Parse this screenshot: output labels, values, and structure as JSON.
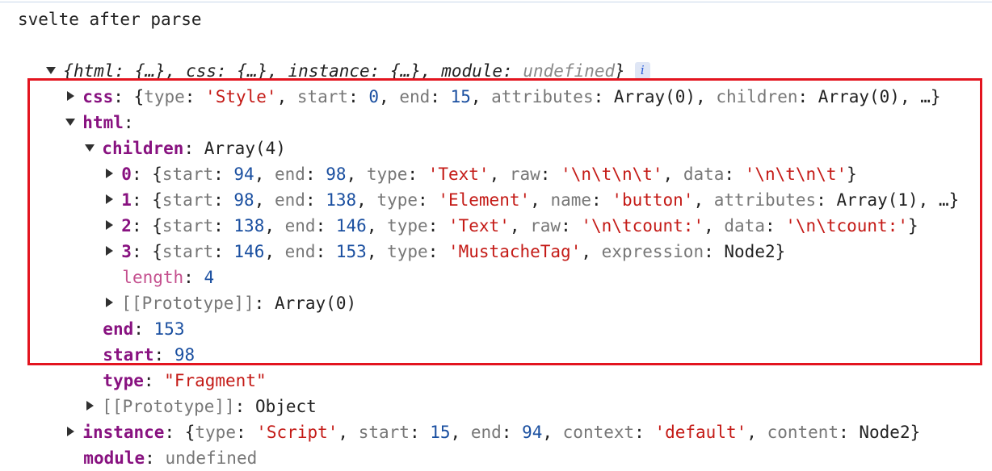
{
  "title": "svelte after parse",
  "summary": {
    "html_key": "html",
    "html_val": "{…}",
    "css_key": "css",
    "css_val": "{…}",
    "instance_key": "instance",
    "instance_val": "{…}",
    "module_key": "module",
    "module_val": "undefined",
    "info_badge": "i"
  },
  "css_row": {
    "key": "css",
    "type_key": "type",
    "type_val": "'Style'",
    "start_key": "start",
    "start_val": "0",
    "end_key": "end",
    "end_val": "15",
    "attrs_key": "attributes",
    "attrs_val": "Array(0)",
    "children_key": "children",
    "children_val": "Array(0)",
    "more": "…"
  },
  "html_row": {
    "key": "html"
  },
  "children_row": {
    "key": "children",
    "val": "Array(4)"
  },
  "items": [
    {
      "index": "0",
      "start_key": "start",
      "start_val": "94",
      "end_key": "end",
      "end_val": "98",
      "type_key": "type",
      "type_val": "'Text'",
      "f4_key": "raw",
      "f4_val": "'\\n\\t\\n\\t'",
      "f5_key": "data",
      "f5_val": "'\\n\\t\\n\\t'",
      "tail": "}"
    },
    {
      "index": "1",
      "start_key": "start",
      "start_val": "98",
      "end_key": "end",
      "end_val": "138",
      "type_key": "type",
      "type_val": "'Element'",
      "f4_key": "name",
      "f4_val": "'button'",
      "f5_key": "attributes",
      "f5_val": "Array(1)",
      "tail": ", …}"
    },
    {
      "index": "2",
      "start_key": "start",
      "start_val": "138",
      "end_key": "end",
      "end_val": "146",
      "type_key": "type",
      "type_val": "'Text'",
      "f4_key": "raw",
      "f4_val": "'\\n\\tcount:'",
      "f5_key": "data",
      "f5_val": "'\\n\\tcount:'",
      "tail": "}"
    },
    {
      "index": "3",
      "start_key": "start",
      "start_val": "146",
      "end_key": "end",
      "end_val": "153",
      "type_key": "type",
      "type_val": "'MustacheTag'",
      "f4_key": "expression",
      "f4_val": "Node2",
      "tail": "}"
    }
  ],
  "length_row": {
    "key": "length",
    "val": "4"
  },
  "proto_array": {
    "key": "[[Prototype]]",
    "val": "Array(0)"
  },
  "end_row": {
    "key": "end",
    "val": "153"
  },
  "start_row": {
    "key": "start",
    "val": "98"
  },
  "type_row": {
    "key": "type",
    "val": "\"Fragment\""
  },
  "proto_object": {
    "key": "[[Prototype]]",
    "val": "Object"
  },
  "instance_row": {
    "key": "instance",
    "type_key": "type",
    "type_val": "'Script'",
    "start_key": "start",
    "start_val": "15",
    "end_key": "end",
    "end_val": "94",
    "context_key": "context",
    "context_val": "'default'",
    "content_key": "content",
    "content_val": "Node2"
  },
  "module_row": {
    "key": "module",
    "val": "undefined"
  }
}
